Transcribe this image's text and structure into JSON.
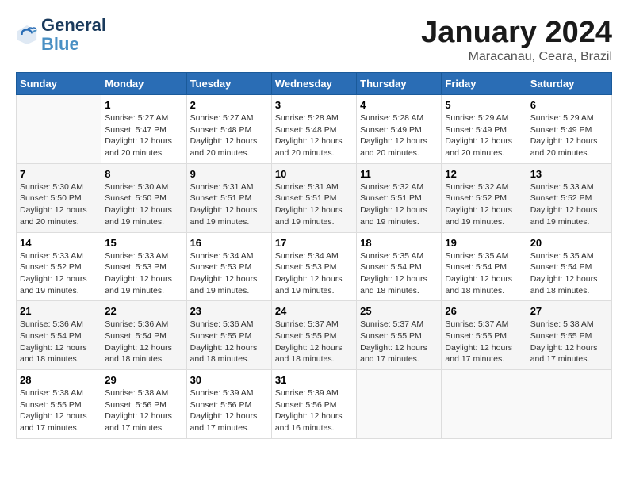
{
  "header": {
    "logo_line1": "General",
    "logo_line2": "Blue",
    "month": "January 2024",
    "location": "Maracanau, Ceara, Brazil"
  },
  "days_of_week": [
    "Sunday",
    "Monday",
    "Tuesday",
    "Wednesday",
    "Thursday",
    "Friday",
    "Saturday"
  ],
  "weeks": [
    [
      {
        "day": "",
        "info": ""
      },
      {
        "day": "1",
        "info": "Sunrise: 5:27 AM\nSunset: 5:47 PM\nDaylight: 12 hours\nand 20 minutes."
      },
      {
        "day": "2",
        "info": "Sunrise: 5:27 AM\nSunset: 5:48 PM\nDaylight: 12 hours\nand 20 minutes."
      },
      {
        "day": "3",
        "info": "Sunrise: 5:28 AM\nSunset: 5:48 PM\nDaylight: 12 hours\nand 20 minutes."
      },
      {
        "day": "4",
        "info": "Sunrise: 5:28 AM\nSunset: 5:49 PM\nDaylight: 12 hours\nand 20 minutes."
      },
      {
        "day": "5",
        "info": "Sunrise: 5:29 AM\nSunset: 5:49 PM\nDaylight: 12 hours\nand 20 minutes."
      },
      {
        "day": "6",
        "info": "Sunrise: 5:29 AM\nSunset: 5:49 PM\nDaylight: 12 hours\nand 20 minutes."
      }
    ],
    [
      {
        "day": "7",
        "info": "Sunrise: 5:30 AM\nSunset: 5:50 PM\nDaylight: 12 hours\nand 20 minutes."
      },
      {
        "day": "8",
        "info": "Sunrise: 5:30 AM\nSunset: 5:50 PM\nDaylight: 12 hours\nand 19 minutes."
      },
      {
        "day": "9",
        "info": "Sunrise: 5:31 AM\nSunset: 5:51 PM\nDaylight: 12 hours\nand 19 minutes."
      },
      {
        "day": "10",
        "info": "Sunrise: 5:31 AM\nSunset: 5:51 PM\nDaylight: 12 hours\nand 19 minutes."
      },
      {
        "day": "11",
        "info": "Sunrise: 5:32 AM\nSunset: 5:51 PM\nDaylight: 12 hours\nand 19 minutes."
      },
      {
        "day": "12",
        "info": "Sunrise: 5:32 AM\nSunset: 5:52 PM\nDaylight: 12 hours\nand 19 minutes."
      },
      {
        "day": "13",
        "info": "Sunrise: 5:33 AM\nSunset: 5:52 PM\nDaylight: 12 hours\nand 19 minutes."
      }
    ],
    [
      {
        "day": "14",
        "info": "Sunrise: 5:33 AM\nSunset: 5:52 PM\nDaylight: 12 hours\nand 19 minutes."
      },
      {
        "day": "15",
        "info": "Sunrise: 5:33 AM\nSunset: 5:53 PM\nDaylight: 12 hours\nand 19 minutes."
      },
      {
        "day": "16",
        "info": "Sunrise: 5:34 AM\nSunset: 5:53 PM\nDaylight: 12 hours\nand 19 minutes."
      },
      {
        "day": "17",
        "info": "Sunrise: 5:34 AM\nSunset: 5:53 PM\nDaylight: 12 hours\nand 19 minutes."
      },
      {
        "day": "18",
        "info": "Sunrise: 5:35 AM\nSunset: 5:54 PM\nDaylight: 12 hours\nand 18 minutes."
      },
      {
        "day": "19",
        "info": "Sunrise: 5:35 AM\nSunset: 5:54 PM\nDaylight: 12 hours\nand 18 minutes."
      },
      {
        "day": "20",
        "info": "Sunrise: 5:35 AM\nSunset: 5:54 PM\nDaylight: 12 hours\nand 18 minutes."
      }
    ],
    [
      {
        "day": "21",
        "info": "Sunrise: 5:36 AM\nSunset: 5:54 PM\nDaylight: 12 hours\nand 18 minutes."
      },
      {
        "day": "22",
        "info": "Sunrise: 5:36 AM\nSunset: 5:54 PM\nDaylight: 12 hours\nand 18 minutes."
      },
      {
        "day": "23",
        "info": "Sunrise: 5:36 AM\nSunset: 5:55 PM\nDaylight: 12 hours\nand 18 minutes."
      },
      {
        "day": "24",
        "info": "Sunrise: 5:37 AM\nSunset: 5:55 PM\nDaylight: 12 hours\nand 18 minutes."
      },
      {
        "day": "25",
        "info": "Sunrise: 5:37 AM\nSunset: 5:55 PM\nDaylight: 12 hours\nand 17 minutes."
      },
      {
        "day": "26",
        "info": "Sunrise: 5:37 AM\nSunset: 5:55 PM\nDaylight: 12 hours\nand 17 minutes."
      },
      {
        "day": "27",
        "info": "Sunrise: 5:38 AM\nSunset: 5:55 PM\nDaylight: 12 hours\nand 17 minutes."
      }
    ],
    [
      {
        "day": "28",
        "info": "Sunrise: 5:38 AM\nSunset: 5:55 PM\nDaylight: 12 hours\nand 17 minutes."
      },
      {
        "day": "29",
        "info": "Sunrise: 5:38 AM\nSunset: 5:56 PM\nDaylight: 12 hours\nand 17 minutes."
      },
      {
        "day": "30",
        "info": "Sunrise: 5:39 AM\nSunset: 5:56 PM\nDaylight: 12 hours\nand 17 minutes."
      },
      {
        "day": "31",
        "info": "Sunrise: 5:39 AM\nSunset: 5:56 PM\nDaylight: 12 hours\nand 16 minutes."
      },
      {
        "day": "",
        "info": ""
      },
      {
        "day": "",
        "info": ""
      },
      {
        "day": "",
        "info": ""
      }
    ]
  ]
}
